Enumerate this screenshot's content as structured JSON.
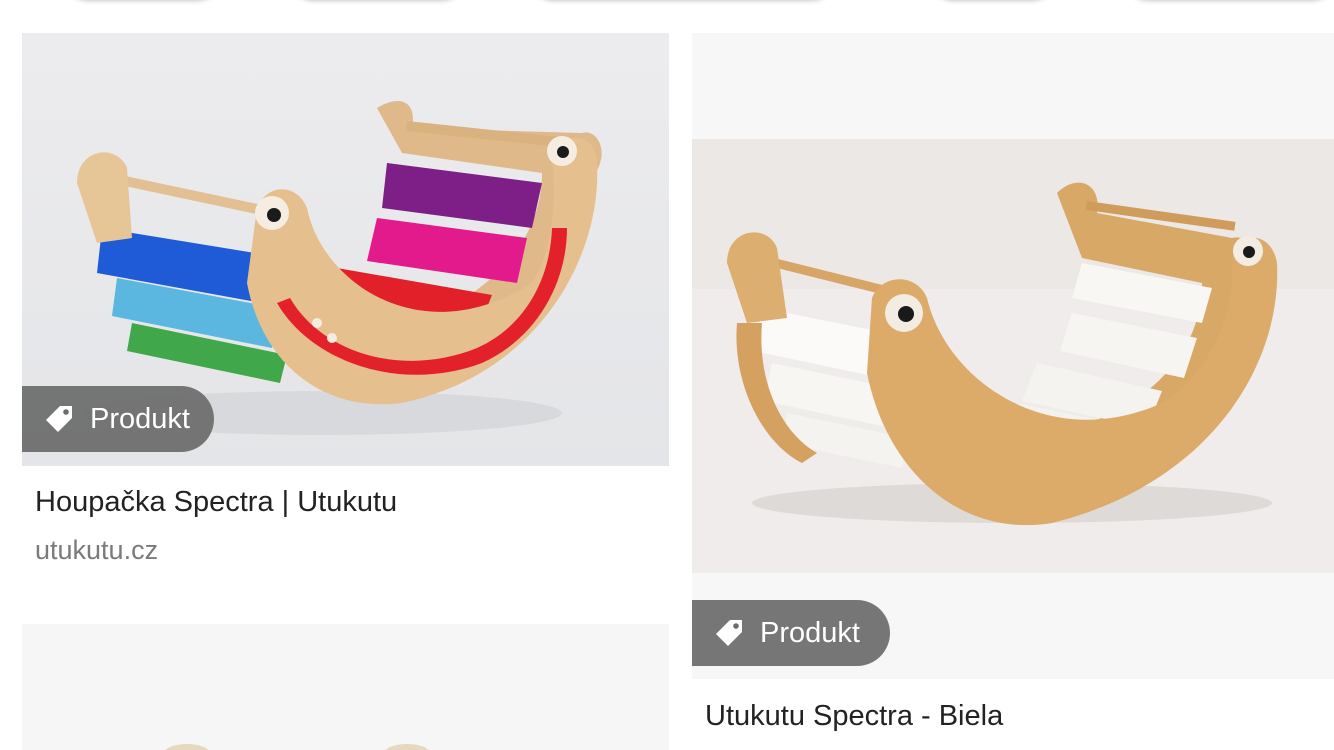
{
  "top_chips": [
    {
      "name": "filter-chip-1"
    },
    {
      "name": "filter-chip-2"
    },
    {
      "name": "filter-chip-3"
    },
    {
      "name": "filter-chip-4"
    },
    {
      "name": "filter-chip-5"
    }
  ],
  "results": [
    {
      "badge_label": "Produkt",
      "badge_icon": "tag-icon",
      "title": "Houpačka Spectra | Utukutu",
      "source": "utukutu.cz",
      "image": "rainbow-rocker"
    },
    {
      "badge_label": "Produkt",
      "badge_icon": "tag-icon",
      "title": "Utukutu Spectra - Biela",
      "image": "natural-rocker"
    },
    {
      "image": "partial-rocker"
    }
  ],
  "colors": {
    "badge_bg": "#6c6c6c",
    "title_text": "#222222",
    "source_text": "#7a7a7a",
    "card_bg": "#f7f7f7"
  }
}
